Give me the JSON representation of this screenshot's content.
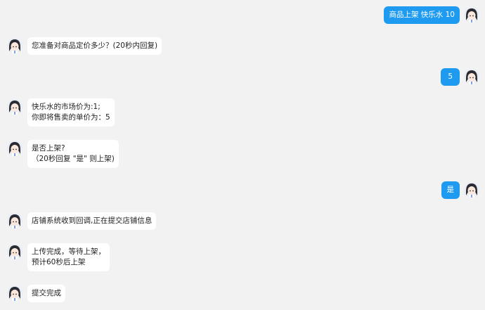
{
  "chat": {
    "messages": [
      {
        "side": "right",
        "text": "商品上架 快乐水 10"
      },
      {
        "side": "left",
        "text": "您准备对商品定价多少？(20秒内回复)"
      },
      {
        "side": "right",
        "text": "5"
      },
      {
        "side": "left",
        "text": "快乐水的市场价为:1;\n你即将售卖的单价为：5"
      },
      {
        "side": "left",
        "text": "是否上架?\n（20秒回复 \"是\" 则上架)"
      },
      {
        "side": "right",
        "text": "是"
      },
      {
        "side": "left",
        "text": "店铺系统收到回调,正在提交店铺信息"
      },
      {
        "side": "left",
        "text": "上传完成，等待上架，\n预计60秒后上架"
      },
      {
        "side": "left",
        "text": "提交完成"
      }
    ]
  },
  "colors": {
    "background": "#f2f2f2",
    "user_bubble": "#1e9bf0",
    "bot_bubble": "#ffffff"
  },
  "icons": {
    "avatar": "anime-avatar-icon"
  }
}
